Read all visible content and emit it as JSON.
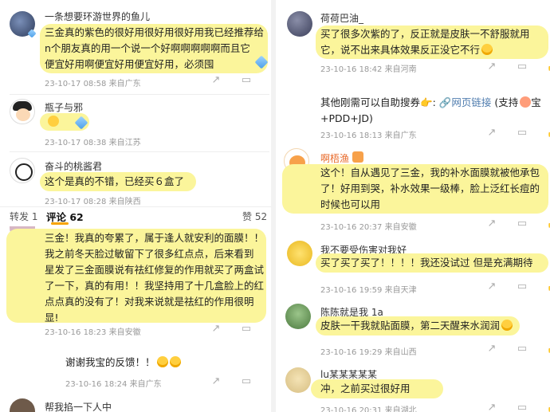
{
  "left": {
    "c1": {
      "name": "一条想要环游世界的鱼儿",
      "lines": [
        "三金真的紫色的很好用很好用很好用我已经推荐给",
        "n个朋友真的用一个说一个好啊啊啊啊啊而且它",
        "便宜好用啊便宜好用便宜好用，必须囤"
      ],
      "meta": "23-10-17 08:58 来自广东"
    },
    "c2": {
      "name": "瓶子与邪",
      "meta": "23-10-17 08:38 来自江苏"
    },
    "c3": {
      "name": "奋斗的桃酱君",
      "text": "这个是真的不错，已经买６盒了",
      "meta": "23-10-17 08:28 来自陕西"
    },
    "tabs": {
      "repost": "转发 1",
      "comment": "评论 62",
      "like": "赞 52"
    },
    "c4": {
      "lines": [
        "三金！我真的夸累了，属于逢人就安利的面膜！！",
        "我之前冬天脸过敏留下了很多红点点，后来看到",
        "星发了三金面膜说有祛红修复的作用就买了两盒试",
        "了一下，真的有用！！我坚持用了十几盒脸上的红",
        "点点真的没有了！对我来说就是祛红的作用很明",
        "显!"
      ],
      "meta": "23-10-16 18:23 来自安徽"
    },
    "c5": {
      "text": "谢谢我宝的反馈！！",
      "meta": "23-10-16 18:24 来自广东"
    },
    "c6": {
      "name": "帮我掐一下人中"
    }
  },
  "right": {
    "r1": {
      "name": "荷荷巴油_",
      "lines": [
        "买了很多次紫的了，反正就是皮肤一不舒服就用",
        "它，说不出来具体效果反正没它不行"
      ],
      "meta": "23-10-16 18:42 来自河南"
    },
    "r2": {
      "line1": "其他刚需可以自助搜券👉:",
      "link": "网页链接",
      "line1b": "(支持",
      "line1c": "宝",
      "line2": "+PDD+JD)",
      "meta": "23-10-16 18:13 来自广东"
    },
    "r3": {
      "name": "啊梧渔",
      "lines": [
        "这个！自从遇见了三金，我的补水面膜就被他承包",
        "了！好用到哭，补水效果一级棒，脸上泛红长痘的",
        "时候也可以用"
      ],
      "meta": "23-10-16 20:37 来自安徽"
    },
    "r4": {
      "name": "我不要受伤害对我好",
      "text": "买了买了买了！！！！我还没试过 但是充满期待",
      "meta": "23-10-16 19:59 来自天津"
    },
    "r5": {
      "name": "陈陈就是我 1a",
      "text": "皮肤一干我就贴面膜，第二天醒来水润润",
      "meta": "23-10-16 19:29 来自山西"
    },
    "r6": {
      "name": "lu某某某某某",
      "text": "冲，之前买过很好用",
      "meta": "23-10-16 20:31 来自湖北"
    }
  },
  "icons": [
    "share-icon",
    "comment-icon",
    "like-icon"
  ]
}
